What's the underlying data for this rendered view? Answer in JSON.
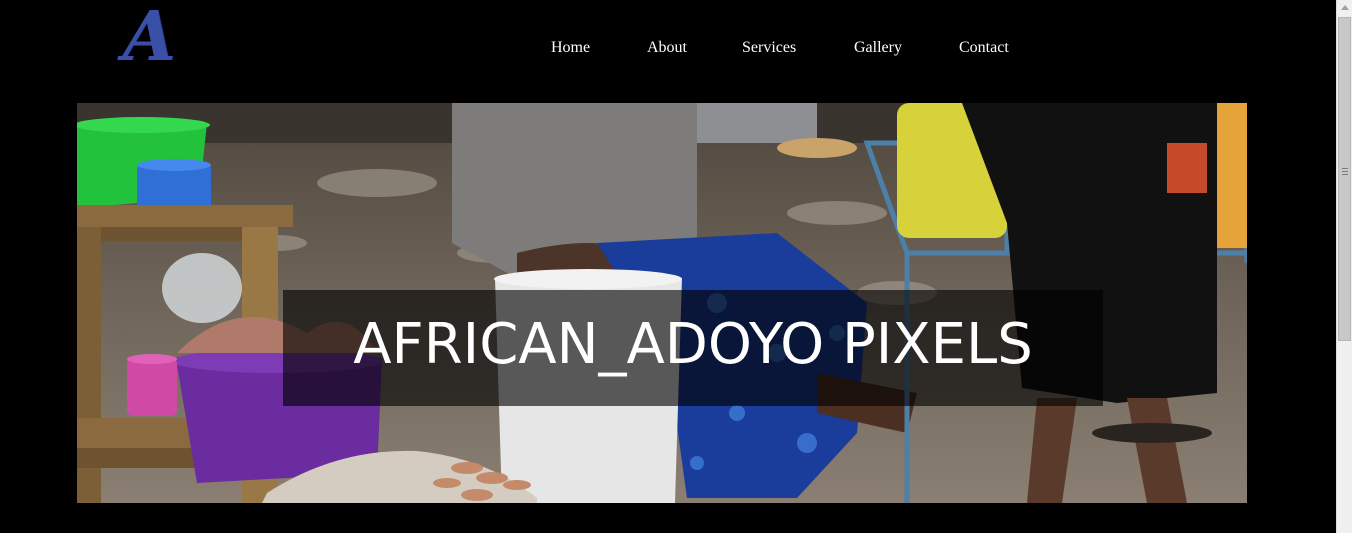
{
  "header": {
    "logo_letter": "A",
    "nav": [
      {
        "label": "Home"
      },
      {
        "label": "About"
      },
      {
        "label": "Services"
      },
      {
        "label": "Gallery"
      },
      {
        "label": "Contact"
      }
    ]
  },
  "hero": {
    "title": "AFRICAN_ADOYO PIXELS"
  },
  "colors": {
    "background": "#000000",
    "logo": "#3a4fa8",
    "nav_text": "#ffffff",
    "banner_overlay": "rgba(0,0,0,0.62)"
  }
}
